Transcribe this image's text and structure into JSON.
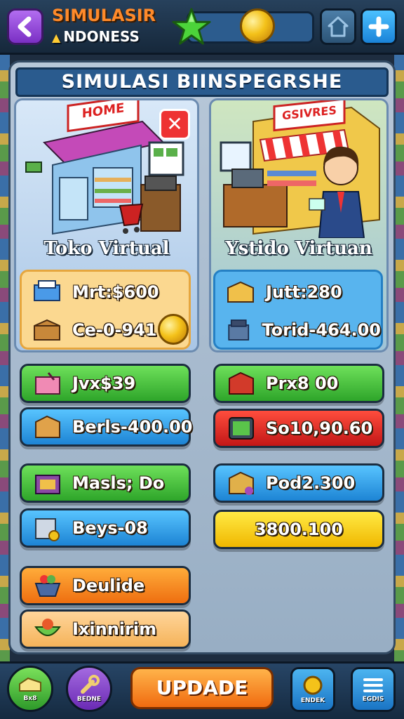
{
  "header": {
    "title": "SIMULASIR",
    "subtitle": "NDONESS",
    "icons": {
      "back": "chevron-left-icon",
      "level": "star-icon",
      "currency": "coin-icon",
      "home": "home-icon",
      "add": "plus-icon"
    }
  },
  "banner": {
    "title": "SIMULASI BIINSPEGRSHE"
  },
  "cards": {
    "left": {
      "title": "Toko Virtual",
      "sign": "HOME"
    },
    "right": {
      "title": "Ystido Virtuan",
      "sign": "GSIVRES"
    }
  },
  "info_left": {
    "row1": "Mrt:$600",
    "row2": "Ce-0-941"
  },
  "info_right": {
    "row1": "Jutt:280",
    "row2": "Torid-464.00"
  },
  "stats_left": [
    {
      "label": "Jvx$39",
      "color": "green"
    },
    {
      "label": "Berls-400.00",
      "color": "blue"
    },
    {
      "label": "Masls; Do",
      "color": "green"
    },
    {
      "label": "Beys-08",
      "color": "blue"
    },
    {
      "label": "Deulide",
      "color": "orange"
    },
    {
      "label": "Ixinnirim",
      "color": "peach"
    }
  ],
  "stats_right": [
    {
      "label": "Prx8 00",
      "color": "green"
    },
    {
      "label": "So10,90.60",
      "color": "red"
    },
    {
      "label": "Pod2.300",
      "color": "blue"
    },
    {
      "label": "3800.100",
      "color": "yellow"
    }
  ],
  "bottom": {
    "btn1": "Bx8",
    "btn2": "BEDNE",
    "update": "UPDADE",
    "btn4": "ENDEK",
    "btn5": "EGDIS"
  },
  "colors": {
    "accent": "#ff8a2a",
    "green": "#2ea52a",
    "blue": "#1d84d4",
    "red": "#c21717",
    "yellow": "#f0b800",
    "orange": "#ee6e10"
  }
}
